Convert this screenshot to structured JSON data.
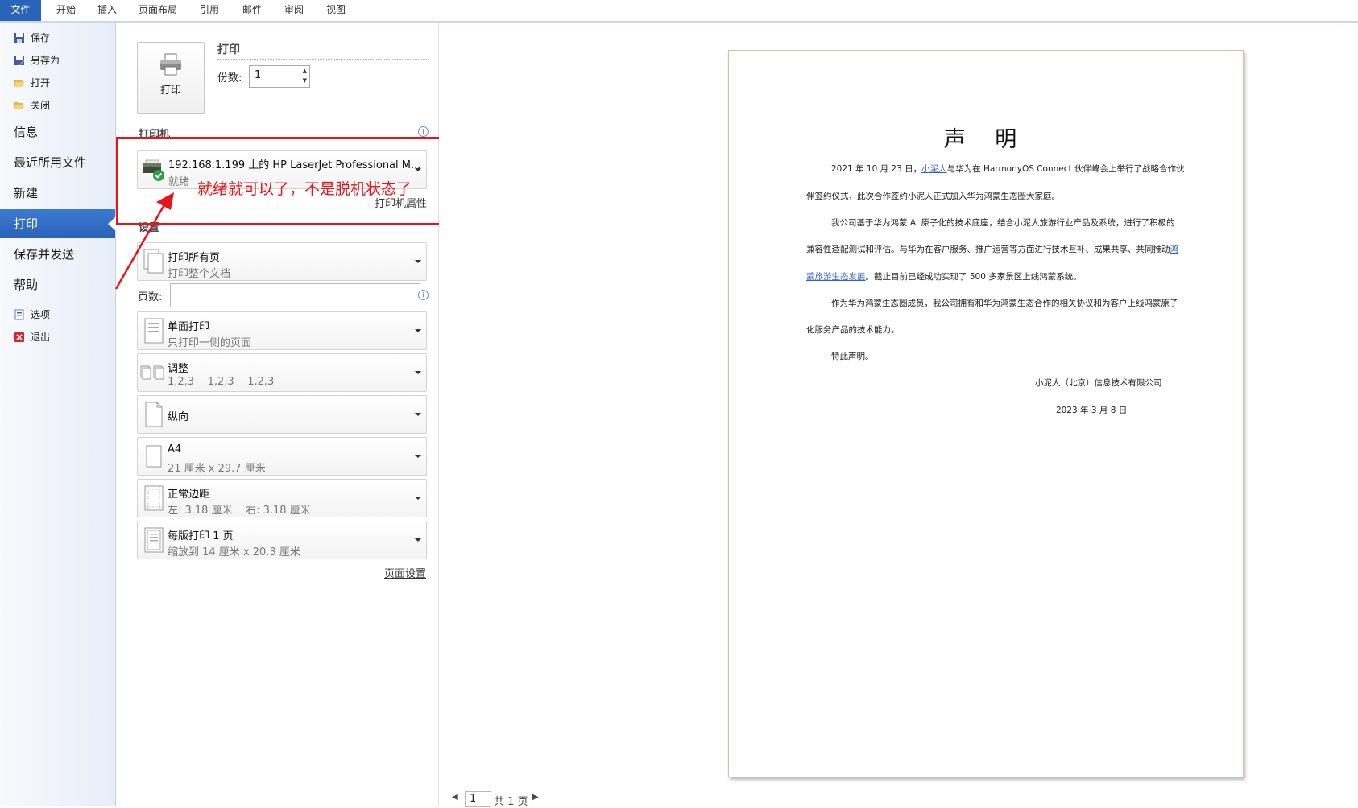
{
  "ribbon": {
    "tabs": [
      "文件",
      "开始",
      "插入",
      "页面布局",
      "引用",
      "邮件",
      "审阅",
      "视图"
    ]
  },
  "nav": {
    "save": "保存",
    "save_as": "另存为",
    "open": "打开",
    "close": "关闭",
    "info": "信息",
    "recent": "最近所用文件",
    "new": "新建",
    "print": "打印",
    "save_send": "保存并发送",
    "help": "帮助",
    "options": "选项",
    "exit": "退出"
  },
  "print_section": {
    "heading": "打印",
    "button_label": "打印",
    "copies_label": "份数:",
    "copies_value": "1"
  },
  "printer": {
    "heading": "打印机",
    "name": "192.168.1.199 上的 HP LaserJet Professional M...",
    "status": "就绪",
    "properties_link": "打印机属性"
  },
  "settings": {
    "heading": "设置",
    "range": {
      "title": "打印所有页",
      "subtitle": "打印整个文档"
    },
    "pages_label": "页数:",
    "pages_value": "",
    "sides": {
      "title": "单面打印",
      "subtitle": "只打印一侧的页面"
    },
    "collate": {
      "title": "调整",
      "subtitle": "1,2,3    1,2,3    1,2,3"
    },
    "orientation": {
      "title": "纵向"
    },
    "paper": {
      "title": "A4",
      "subtitle": "21 厘米 x 29.7 厘米"
    },
    "margins": {
      "title": "正常边距",
      "subtitle": "左: 3.18 厘米    右: 3.18 厘米"
    },
    "per_sheet": {
      "title": "每版打印 1 页",
      "subtitle": "缩放到 14 厘米 x 20.3 厘米"
    },
    "page_setup_link": "页面设置"
  },
  "annotation": {
    "text": "就绪就可以了，不是脱机状态了",
    "color": "#e8141b"
  },
  "document": {
    "title": "声 明",
    "p1_a": "2021 年 10 月 23 日，",
    "p1_link": "小泥人",
    "p1_b": "与华为在 HarmonyOS  Connect 伙伴峰会上举行了战略合作伙",
    "p1_c": "伴签约仪式，此次合作签约小泥人正式加入华为鸿蒙生态圈大家庭。",
    "p2_a": "我公司基于华为鸿蒙  AI 原子化的技术底座，结合小泥人旅游行业产品及系统，进行了积极的",
    "p2_b": "兼容性适配测试和评估。与华为在客户服务、推广运营等方面进行技术互补、成果共享、共同推动",
    "p2_link1": "鸿",
    "p2_link2": "蒙旅游生态发展",
    "p2_c": "。截止目前已经成功实现了 500 多家景区上线鸿蒙系统。",
    "p3_a": "作为华为鸿蒙生态圈成员，我公司拥有和华为鸿蒙生态合作的相关协议和为客户上线鸿蒙原子",
    "p3_b": "化服务产品的技术能力。",
    "p4": "特此声明。",
    "signature": "小泥人（北京）信息技术有限公司",
    "date": "2023 年 3 月 8 日"
  },
  "pager": {
    "current": "1",
    "total_text": "共 1 页"
  },
  "colors": {
    "file_tab": "#2a64b8",
    "nav_active": "#2a62b8",
    "link_blue": "#2c5fd6",
    "annotation_red": "#e8141b"
  }
}
